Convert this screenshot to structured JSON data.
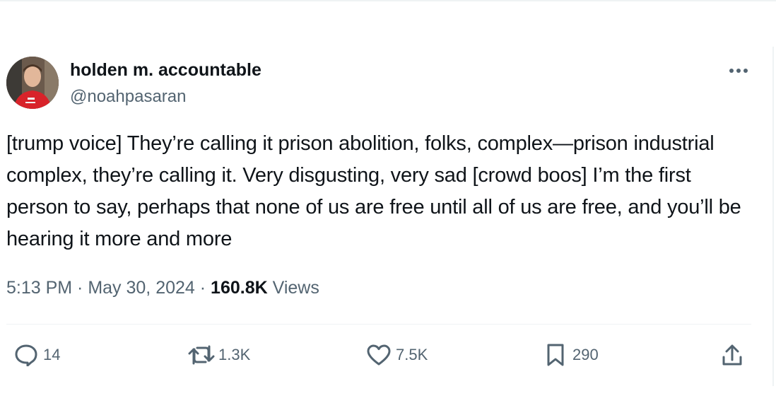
{
  "author": {
    "display_name": "holden m. accountable",
    "handle": "@noahpasaran"
  },
  "tweet": {
    "text": "[trump voice] They’re calling it prison abolition, folks, complex—prison industrial complex, they’re calling it. Very disgusting, very sad [crowd boos] I’m the first person to say, perhaps that none of us are free until all of us are free, and you’ll be hearing it more and more",
    "time": "5:13 PM",
    "separator": " · ",
    "date": "May 30, 2024",
    "views_count": "160.8K",
    "views_label": " Views"
  },
  "actions": {
    "reply_count": "14",
    "retweet_count": "1.3K",
    "like_count": "7.5K",
    "bookmark_count": "290"
  },
  "icons": {
    "more": "more-horizontal-icon",
    "reply": "speech-bubble-icon",
    "retweet": "retweet-arrows-icon",
    "like": "heart-icon",
    "bookmark": "bookmark-icon",
    "share": "share-upload-icon"
  },
  "colors": {
    "text_primary": "#0f1419",
    "text_secondary": "#536471",
    "divider": "#eff3f4"
  }
}
